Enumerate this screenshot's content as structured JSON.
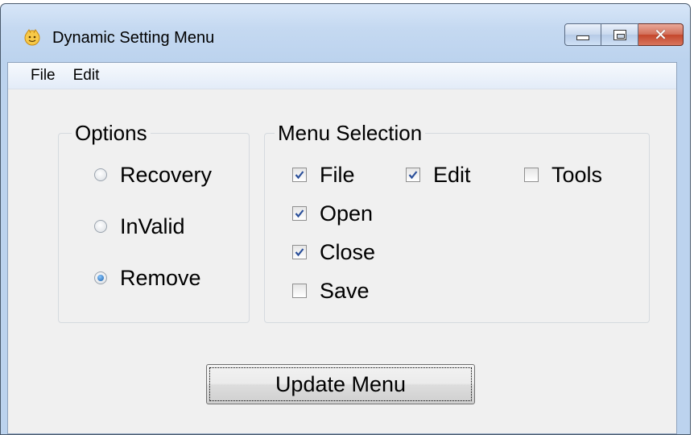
{
  "window": {
    "title": "Dynamic Setting Menu",
    "app_icon": "smiley-icon",
    "controls": {
      "minimize": "minimize-icon",
      "maximize": "maximize-icon",
      "close": "✕"
    }
  },
  "menubar": {
    "items": [
      "File",
      "Edit"
    ]
  },
  "options_group": {
    "title": "Options",
    "radios": [
      {
        "label": "Recovery",
        "checked": false
      },
      {
        "label": "InValid",
        "checked": false
      },
      {
        "label": "Remove",
        "checked": true
      }
    ]
  },
  "menu_selection_group": {
    "title": "Menu Selection",
    "checkboxes": [
      {
        "label": "File",
        "checked": true
      },
      {
        "label": "Edit",
        "checked": true
      },
      {
        "label": "Tools",
        "checked": false
      },
      {
        "label": "Open",
        "checked": true
      },
      {
        "label": "Close",
        "checked": true
      },
      {
        "label": "Save",
        "checked": false
      }
    ]
  },
  "update_button": {
    "label": "Update Menu"
  },
  "colors": {
    "check_mark": "#2a4f9a",
    "radio_selected": "#1b5fa8",
    "title_bar": "#c5d9f1"
  }
}
